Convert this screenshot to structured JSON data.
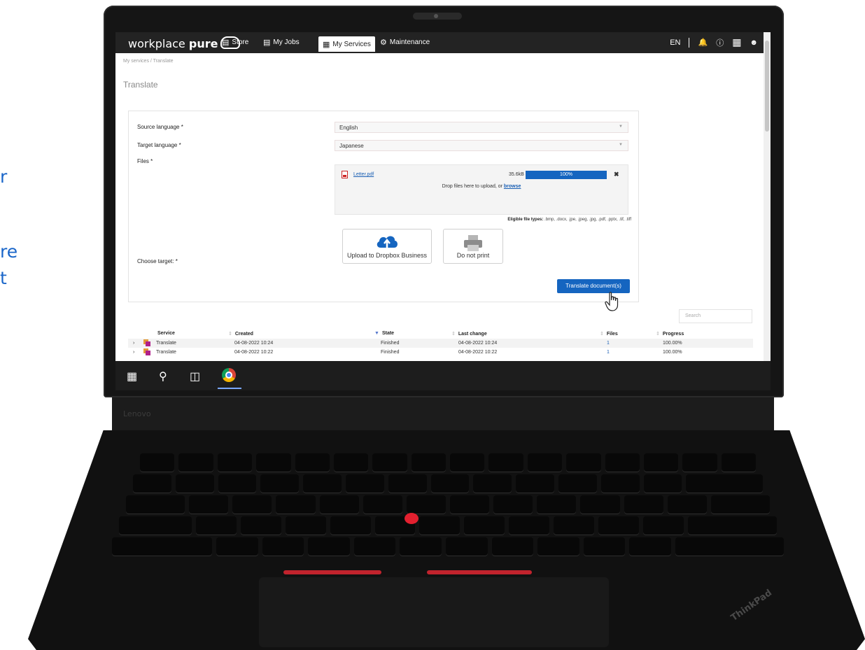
{
  "promo_fragments": [
    "r",
    "re",
    "t"
  ],
  "laptop": {
    "brand_chin": "Lenovo",
    "brand_palmrest": "ThinkPad"
  },
  "app": {
    "logo_text_light": "workplace ",
    "logo_text_bold": "pure",
    "nav": [
      {
        "label": "Store",
        "icon": "store-icon"
      },
      {
        "label": "My Jobs",
        "icon": "printer-icon"
      },
      {
        "label": "My Services",
        "icon": "grid-icon",
        "active": true
      },
      {
        "label": "Maintenance",
        "icon": "gear-icon"
      }
    ],
    "language": "EN",
    "right_icons": [
      "bell-icon",
      "help-icon",
      "apps-grid-icon",
      "user-icon"
    ]
  },
  "breadcrumb": "My services / Translate",
  "page_title": "Translate",
  "form": {
    "source_language_label": "Source language *",
    "source_language_value": "English",
    "target_language_label": "Target language *",
    "target_language_value": "Japanese",
    "files_label": "Files *",
    "file": {
      "name": "Letter.pdf",
      "size": "35.6kB",
      "progress_label": "100%",
      "progress": 1.0
    },
    "drop_text": "Drop files here to upload, or ",
    "drop_link": "browse",
    "eligible_label": "Eligible file types:",
    "eligible_types": " .bmp, .docx, .jpe, .jpeg, .jpg, .pdf, .pptx, .tif, .tiff",
    "choose_target_label": "Choose target: *",
    "targets": [
      {
        "label": "Upload to Dropbox Business",
        "icon": "cloud-upload-icon"
      },
      {
        "label": "Do not print",
        "icon": "printer-icon"
      }
    ],
    "submit_label": "Translate document(s)"
  },
  "search_placeholder": "Search",
  "table": {
    "headers": [
      "Service",
      "Created",
      "State",
      "Last change",
      "Files",
      "Progress"
    ],
    "rows": [
      {
        "service": "Translate",
        "created": "04-08-2022 10:24",
        "state": "Finished",
        "last_change": "04-08-2022 10:24",
        "files": "1",
        "progress": "100.00%"
      },
      {
        "service": "Translate",
        "created": "04-08-2022 10:22",
        "state": "Finished",
        "last_change": "04-08-2022 10:22",
        "files": "1",
        "progress": "100.00%"
      }
    ]
  },
  "taskbar": {
    "items": [
      "windows-start-icon",
      "search-icon",
      "task-view-icon",
      "chrome-icon"
    ]
  },
  "colors": {
    "accent": "#1565c0",
    "nav_bg": "#232323",
    "promo_text": "#1a66c9"
  }
}
